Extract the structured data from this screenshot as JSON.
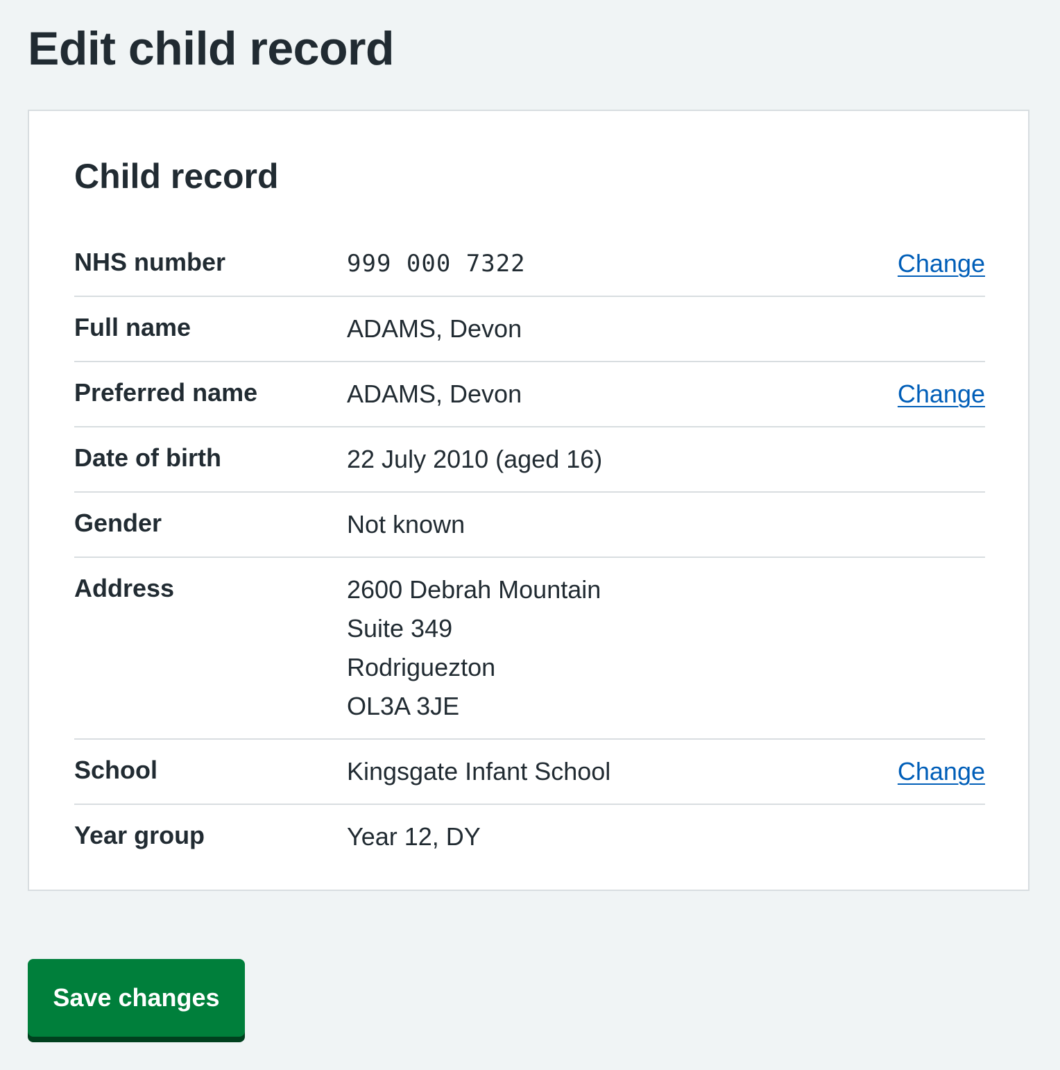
{
  "page": {
    "title": "Edit child record"
  },
  "card": {
    "heading": "Child record",
    "rows": [
      {
        "key": "NHS number",
        "value": "999 000 7322",
        "action": "Change"
      },
      {
        "key": "Full name",
        "value": "ADAMS, Devon"
      },
      {
        "key": "Preferred name",
        "value": "ADAMS, Devon",
        "action": "Change"
      },
      {
        "key": "Date of birth",
        "value": "22 July 2010 (aged 16)"
      },
      {
        "key": "Gender",
        "value": "Not known"
      },
      {
        "key": "Address",
        "lines": [
          "2600 Debrah Mountain",
          "Suite 349",
          "Rodriguezton",
          "OL3A 3JE"
        ]
      },
      {
        "key": "School",
        "value": "Kingsgate Infant School",
        "action": "Change"
      },
      {
        "key": "Year group",
        "value": "Year 12, DY"
      }
    ]
  },
  "actions": {
    "save_label": "Save changes"
  },
  "colors": {
    "background": "#f0f4f5",
    "text": "#212b32",
    "link": "#005eb8",
    "button": "#007f3b",
    "button_shadow": "#00401e",
    "border": "#d8dde0"
  }
}
